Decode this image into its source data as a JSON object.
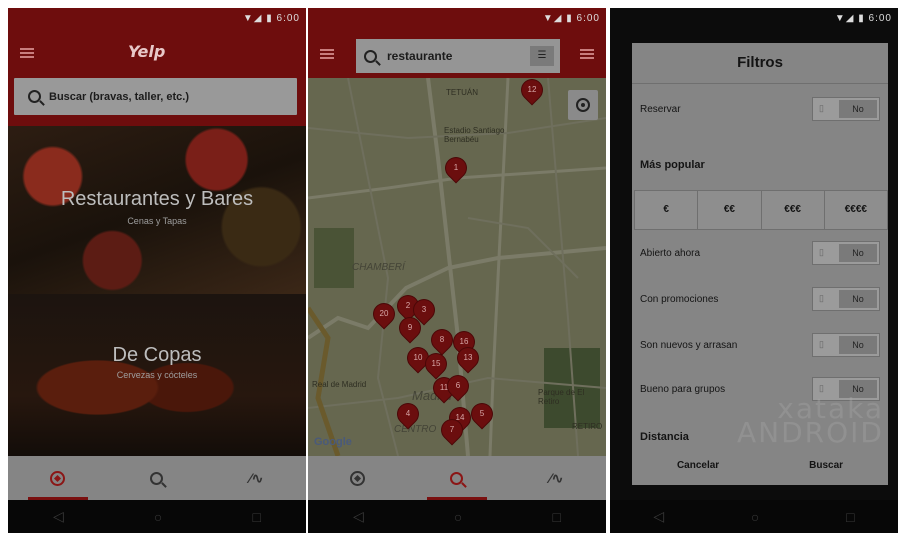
{
  "status": {
    "time": "6:00"
  },
  "phone1": {
    "logo": "Yelp",
    "search_placeholder": "Buscar (bravas, taller, etc.)",
    "cards": [
      {
        "title": "Restaurantes y Bares",
        "subtitle": "Cenas y Tapas"
      },
      {
        "title": "De Copas",
        "subtitle": "Cervezas y cócteles"
      }
    ]
  },
  "phone2": {
    "search_value": "restaurante",
    "map_labels": [
      "TETUÁN",
      "Estadio Santiago Bernabéu",
      "CHAMBERÍ",
      "Madrid",
      "CENTRO",
      "Real de Madrid",
      "Parque de El Retiro",
      "RETIRO"
    ],
    "pins": [
      "12",
      "1",
      "20",
      "2",
      "3",
      "9",
      "8",
      "16",
      "10",
      "13",
      "15",
      "4",
      "11",
      "6",
      "5",
      "14",
      "7"
    ],
    "attribution": "Google"
  },
  "phone3": {
    "title": "Filtros",
    "reservar_label": "Reservar",
    "toggle_no": "No",
    "section_popular": "Más popular",
    "prices": [
      "€",
      "€€",
      "€€€",
      "€€€€"
    ],
    "filters": [
      {
        "label": "Abierto ahora",
        "value": "No"
      },
      {
        "label": "Con promociones",
        "value": "No"
      },
      {
        "label": "Son nuevos y arrasan",
        "value": "No"
      },
      {
        "label": "Bueno para grupos",
        "value": "No"
      }
    ],
    "section_distance": "Distancia",
    "cancel": "Cancelar",
    "search": "Buscar",
    "watermark_line1": "xataka",
    "watermark_line2": "ANDROID"
  },
  "nav_icons": [
    "explore-icon",
    "search-icon",
    "activity-icon"
  ],
  "system_icons": [
    "back-icon",
    "home-icon",
    "recents-icon"
  ],
  "colors": {
    "brand_red": "#6e0d0d",
    "pin_red": "#6b0e0e"
  }
}
